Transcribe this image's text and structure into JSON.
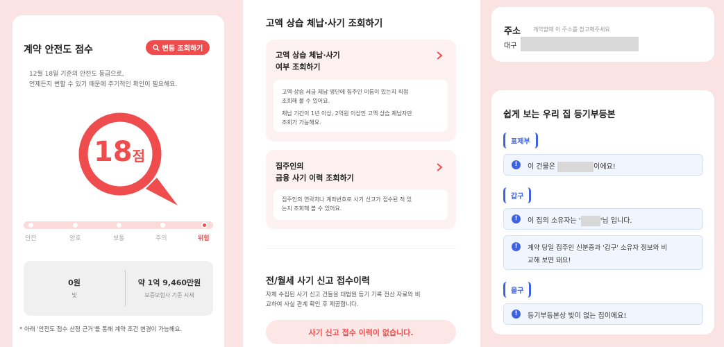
{
  "left": {
    "title": "계약 안전도 점수",
    "change_button": "변동 조회하기",
    "desc_line1": "12월 18일 기준의 안전도 등급으로,",
    "desc_line2": "언제든지 변할 수 있기 때문에 주기적인 확인이 필요해요.",
    "score_number": "18",
    "score_unit": "점",
    "scale_labels": [
      "안전",
      "양호",
      "보통",
      "주의",
      "위험"
    ],
    "active_level": "위험",
    "risk_level_index": 4,
    "stats": {
      "debt_value": "0원",
      "debt_label": "빚",
      "price_value": "약 1억 9,460만원",
      "price_label": "보증보험사 기준 시세"
    },
    "footnote": "* 아래 '안전도 점수 산정 근거'를 통해 계약 조건 변경이 가능해요."
  },
  "middle": {
    "section_title": "고액 상습 체납·사기 조회하기",
    "card1": {
      "title_line1": "고액 상습 체납·사기",
      "title_line2": "여부 조회하기",
      "body1_line1": "고액·상습 세금 체납 명단에 집주인 이름이 있는지 직접",
      "body1_line2": "조회해 볼 수 있어요.",
      "body2_line1": "체납 기간이 1년 이상, 2억원 이상인 고액 상습 체납자만",
      "body2_line2": "조회가 가능해요."
    },
    "card2": {
      "title_line1": "집주인의",
      "title_line2": "금융 사기 이력 조회하기",
      "body_line1": "집주인의 연락처나 계좌번호로 사기 신고가 접수된 적 있",
      "body_line2": "는지 조회해 볼 수 있어요."
    },
    "fraud_title": "전/월세 사기 신고 접수이력",
    "fraud_desc_line1": "자체 수집된 사기 신고 건들을 대법원 등기 기록 전산 자료와 비",
    "fraud_desc_line2": "교하여 사실 관계 확인 후 제공합니다.",
    "fraud_result": "사기 신고 접수 이력이 없습니다."
  },
  "right": {
    "address_label": "주소",
    "address_hint": "계약할때 이 주소를 참고해주세요",
    "address_prefix": "대구",
    "registry_title": "쉽게 보는 우리 집 등기부등본",
    "section1_tag": "표제부",
    "section1_item_pre": "이 건물은",
    "section1_item_post": "이에요!",
    "section2_tag": "갑구",
    "section2_item1_pre": "이 집의 소유자는 '",
    "section2_item1_post": "'님 입니다.",
    "section2_item2_line1": "계약 당일 집주인 신분증과 '갑구' 소유자 정보와 비",
    "section2_item2_line2": "교해 보면 돼요!",
    "section3_tag": "을구",
    "section3_item": "등기부등본상 빚이 없는 집이에요!"
  },
  "colors": {
    "accent": "#ef4d4d",
    "pink_bg": "#fbe3e3",
    "blue": "#3f63e0",
    "blue_bg": "#f1f5fd"
  }
}
